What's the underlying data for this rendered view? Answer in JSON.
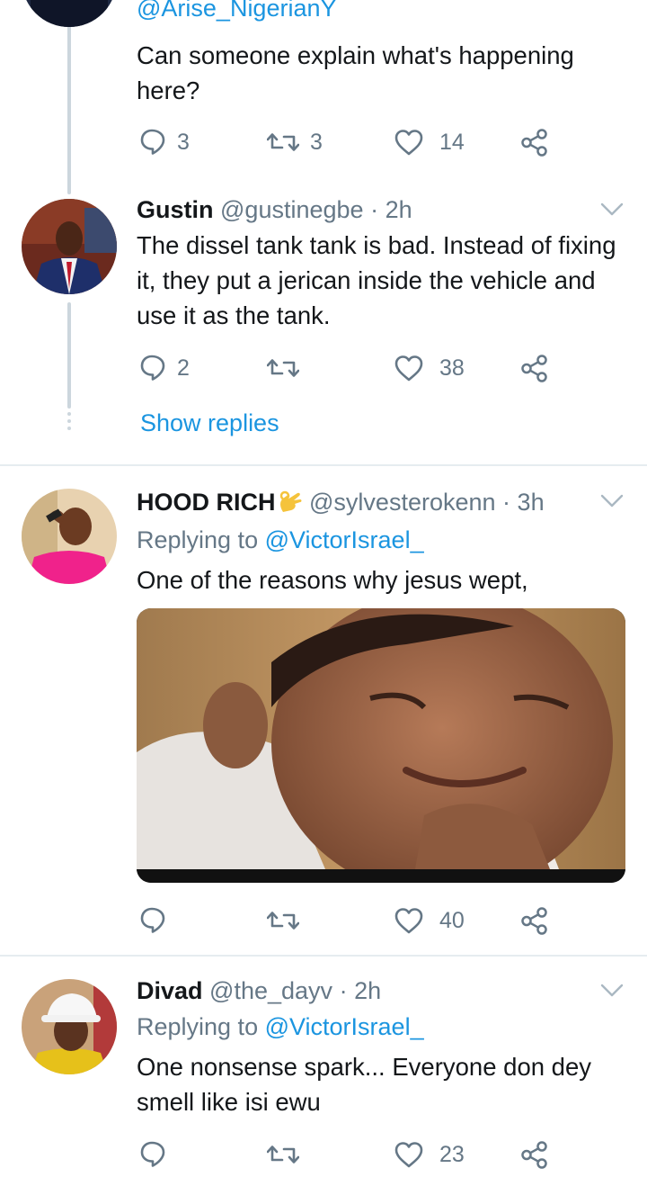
{
  "tweet0": {
    "handle": "@Arise_NigerianY",
    "text": "Can someone explain what's happening here?",
    "replies": "3",
    "retweets": "3",
    "likes": "14"
  },
  "tweet1": {
    "name": "Gustin",
    "handle": "@gustinegbe",
    "dot": "·",
    "time": "2h",
    "text": "The dissel tank tank is bad. Instead of fixing it, they put a jerican inside the vehicle and use it as the tank.",
    "replies": "2",
    "retweets": "",
    "likes": "38",
    "show_replies": "Show replies"
  },
  "tweet2": {
    "name": "HOOD RICH",
    "emoji": "👌",
    "handle": "@sylvesterokenn",
    "dot": "·",
    "time": "3h",
    "replying_label": "Replying to",
    "replying_handle": "@VictorIsrael_",
    "text": "One of the reasons why jesus wept,",
    "replies": "",
    "retweets": "",
    "likes": "40"
  },
  "tweet3": {
    "name": "Divad",
    "handle": "@the_dayv",
    "dot": "·",
    "time": "2h",
    "replying_label": "Replying to",
    "replying_handle": "@VictorIsrael_",
    "text": "One nonsense spark... Everyone don dey smell like isi ewu",
    "replies": "",
    "retweets": "",
    "likes": "23"
  },
  "icons": {
    "reply": "speech-bubble-icon",
    "retweet": "retweet-arrows-icon",
    "like": "heart-icon",
    "share": "share-nodes-icon",
    "more": "chevron-down-icon"
  },
  "colors": {
    "link": "#1b95e0",
    "secondary_text": "#657786",
    "primary_text": "#14171a",
    "divider": "#e6ecf0",
    "thread_line": "#ccd6dd"
  }
}
